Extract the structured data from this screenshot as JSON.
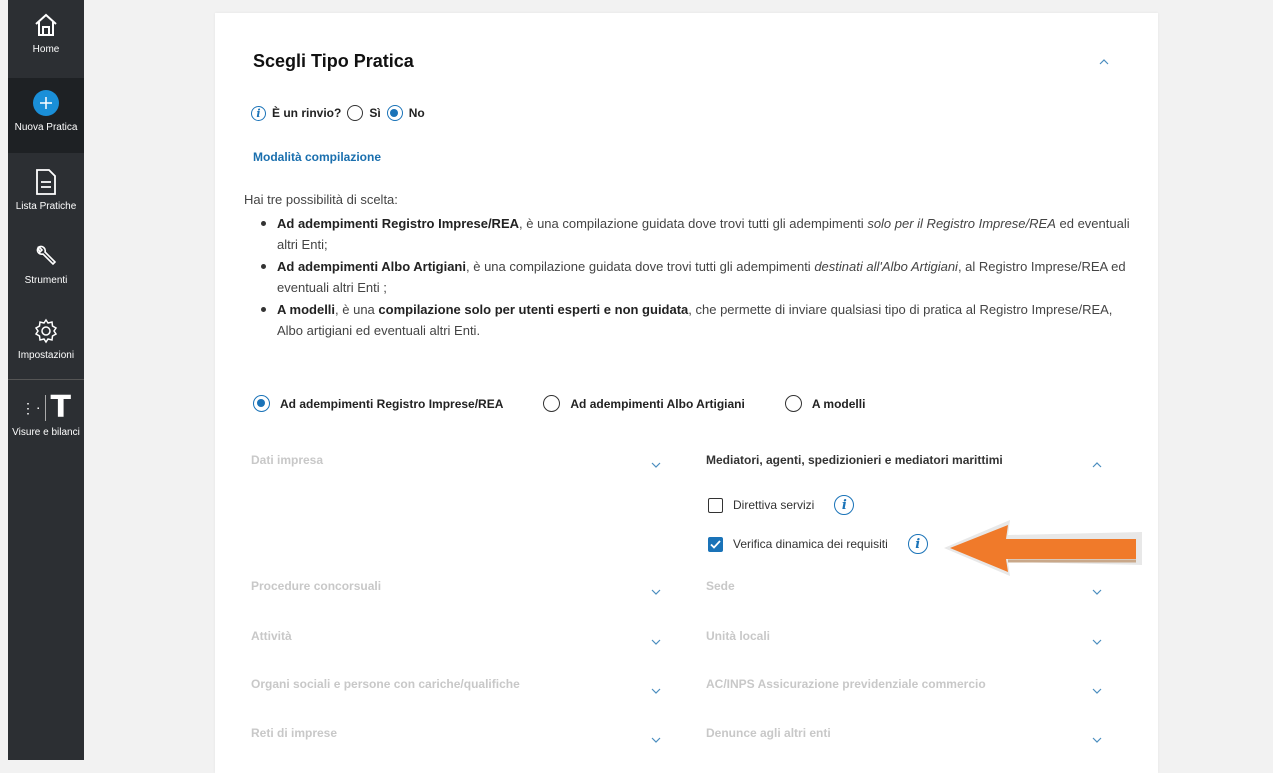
{
  "sidebar": {
    "items": [
      {
        "label": "Home",
        "icon": "home-icon"
      },
      {
        "label": "Nuova Pratica",
        "icon": "plus-circle-icon"
      },
      {
        "label": "Lista Pratiche",
        "icon": "document-icon"
      },
      {
        "label": "Strumenti",
        "icon": "wrench-icon"
      },
      {
        "label": "Impostazioni",
        "icon": "gear-icon"
      },
      {
        "label": "Visure e bilanci",
        "icon": "visure-logo-icon"
      }
    ],
    "visure_logo_glyph": "T"
  },
  "card": {
    "title": "Scegli Tipo Pratica",
    "rinvio": {
      "question": "È un rinvio?",
      "option_si": "Sì",
      "option_no": "No",
      "selected": "No"
    },
    "modalita_link": "Modalità compilazione",
    "intro": "Hai tre possibilità di scelta:",
    "bullets": [
      {
        "bold": "Ad adempimenti Registro Imprese/REA",
        "text1": ", è una compilazione guidata dove trovi tutti gli adempimenti ",
        "italic": "solo per il Registro Imprese/REA",
        "text2": " ed eventuali altri Enti;"
      },
      {
        "bold": "Ad adempimenti Albo Artigiani",
        "text1": ", è una compilazione guidata dove trovi tutti gli adempimenti ",
        "italic": "destinati all'Albo Artigiani",
        "text2": ", al Registro Imprese/REA ed eventuali altri Enti ;"
      },
      {
        "bold": "A modelli",
        "text1": ", è una ",
        "bold2": "compilazione solo per utenti esperti e non guidata",
        "text2": ", che permette di inviare qualsiasi tipo di pratica al Registro Imprese/REA, Albo artigiani ed eventuali altri Enti."
      }
    ],
    "modes": {
      "options": [
        "Ad adempimenti Registro Imprese/REA",
        "Ad adempimenti Albo Artigiani",
        "A modelli"
      ],
      "selected": "Ad adempimenti Registro Imprese/REA"
    },
    "left_sections": [
      "Dati impresa",
      "Procedure concorsuali",
      "Attività",
      "Organi sociali e persone con cariche/qualifiche",
      "Reti di imprese"
    ],
    "right_sections": [
      "Mediatori, agenti, spedizionieri e mediatori marittimi",
      "Sede",
      "Unità locali",
      "AC/INPS Assicurazione previdenziale commercio",
      "Denunce agli altri enti"
    ],
    "mediatori_options": [
      {
        "label": "Direttiva servizi",
        "checked": false
      },
      {
        "label": "Verifica dinamica dei requisiti",
        "checked": true
      }
    ]
  },
  "colors": {
    "accent": "#1a73b8",
    "arrow": "#f07a2a",
    "sidebar": "#2c2f33"
  }
}
